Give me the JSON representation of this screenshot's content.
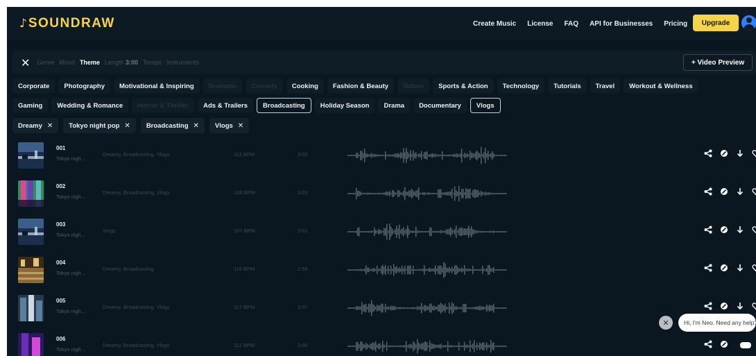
{
  "header": {
    "logo_mark": "♪",
    "logo_text": "SOUNDRAW",
    "nav": [
      "Create Music",
      "License",
      "FAQ",
      "API for Businesses",
      "Pricing"
    ],
    "upgrade_label": "Upgrade",
    "brand_color": "#f5d547",
    "avatar_color": "#2f7fff"
  },
  "filter_bar": {
    "close_label": "✕",
    "tabs": [
      {
        "label": "Genre",
        "active": false
      },
      {
        "label": "Mood",
        "active": false
      },
      {
        "label": "Theme",
        "active": true
      },
      {
        "label": "Length",
        "value": "3:00",
        "active": false
      },
      {
        "label": "Tempo",
        "active": false
      },
      {
        "label": "Instruments",
        "active": false
      }
    ],
    "video_preview_label": "+ Video Preview"
  },
  "theme_chips": {
    "row1": [
      {
        "label": "Corporate",
        "state": "normal"
      },
      {
        "label": "Photography",
        "state": "normal"
      },
      {
        "label": "Motivational & Inspiring",
        "state": "normal"
      },
      {
        "label": "Dramatic",
        "state": "dim"
      },
      {
        "label": "Comedy",
        "state": "dim"
      },
      {
        "label": "Cooking",
        "state": "normal"
      },
      {
        "label": "Fashion & Beauty",
        "state": "normal"
      },
      {
        "label": "Nature",
        "state": "dim"
      },
      {
        "label": "Sports & Action",
        "state": "normal"
      },
      {
        "label": "Technology",
        "state": "normal"
      },
      {
        "label": "Tutorials",
        "state": "normal"
      },
      {
        "label": "Travel",
        "state": "normal"
      },
      {
        "label": "Workout & Wellness",
        "state": "normal"
      }
    ],
    "row2": [
      {
        "label": "Gaming",
        "state": "normal"
      },
      {
        "label": "Wedding & Romance",
        "state": "normal"
      },
      {
        "label": "Horror & Thriller",
        "state": "dim"
      },
      {
        "label": "Ads & Trailers",
        "state": "normal"
      },
      {
        "label": "Broadcasting",
        "state": "selected"
      },
      {
        "label": "Holiday Season",
        "state": "normal"
      },
      {
        "label": "Drama",
        "state": "normal"
      },
      {
        "label": "Documentary",
        "state": "normal"
      },
      {
        "label": "Vlogs",
        "state": "selected"
      }
    ]
  },
  "selected_tags": [
    {
      "label": "Dreamy",
      "x": "✕"
    },
    {
      "label": "Tokyo night pop",
      "x": "✕"
    },
    {
      "label": "Broadcasting",
      "x": "✕"
    },
    {
      "label": "Vlogs",
      "x": "✕"
    }
  ],
  "tracks": [
    {
      "num": "001",
      "name": "Tokyo nigh...",
      "tags": "Dreamy, Broadcasting, Vlogs",
      "bpm": "112 BPM",
      "length": "3:02",
      "thumb": "city-night",
      "colors": [
        "#1b2f4a",
        "#3b5f8a",
        "#c7d6ea"
      ]
    },
    {
      "num": "002",
      "name": "Tokyo nigh...",
      "tags": "Dreamy, Broadcasting, Vlogs",
      "bpm": "106 BPM",
      "length": "3:03",
      "thumb": "neon-street",
      "colors": [
        "#2f8f5a",
        "#d84a9a",
        "#6a3fb8"
      ]
    },
    {
      "num": "003",
      "name": "Tokyo nigh...",
      "tags": "Vlogs",
      "bpm": "107 BPM",
      "length": "3:01",
      "thumb": "city-night",
      "colors": [
        "#1b2f4a",
        "#3b5f8a",
        "#c7d6ea"
      ]
    },
    {
      "num": "004",
      "name": "Tokyo nigh...",
      "tags": "Dreamy, Broadcasting",
      "bpm": "118 BPM",
      "length": "2:56",
      "thumb": "crowd-crossing",
      "colors": [
        "#8a6a3a",
        "#e0c27a",
        "#3a2a1a"
      ]
    },
    {
      "num": "005",
      "name": "Tokyo nigh...",
      "tags": "Dreamy, Broadcasting, Vlogs",
      "bpm": "117 BPM",
      "length": "3:07",
      "thumb": "towers",
      "colors": [
        "#5a7f9a",
        "#c9d9e6",
        "#2a3a4a"
      ]
    },
    {
      "num": "006",
      "name": "Tokyo nigh...",
      "tags": "Dreamy, Broadcasting, Vlogs",
      "bpm": "112 BPM",
      "length": "3:00",
      "thumb": "purple-neon",
      "colors": [
        "#6a2fb8",
        "#d04ad8",
        "#2a1a5a"
      ]
    }
  ],
  "icons": {
    "share": "share-icon",
    "link": "link-icon",
    "download": "download-icon",
    "favorite": "heart-icon"
  },
  "chat": {
    "close_label": "✕",
    "message": "Hi, I'm Neo. Need any help?"
  }
}
